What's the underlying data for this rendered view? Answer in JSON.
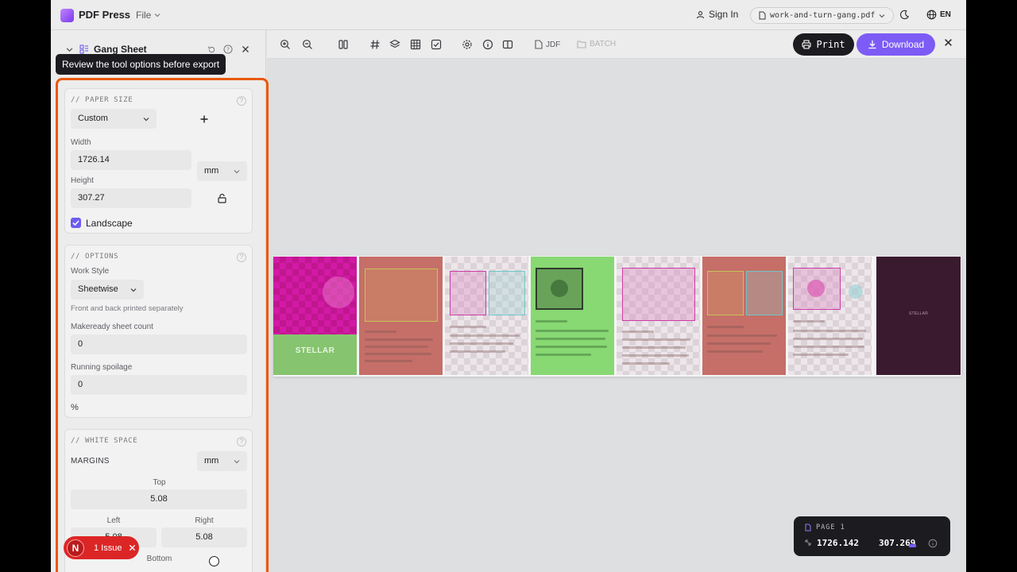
{
  "header": {
    "brand": "PDF Press",
    "file_menu": "File",
    "sign_in": "Sign In",
    "file_name": "work-and-turn-gang.pdf",
    "lang": "EN"
  },
  "sidebar": {
    "title": "Gang Sheet",
    "tooltip": "Review the tool options before export",
    "paper_size": {
      "heading": "// PAPER SIZE",
      "preset": "Custom",
      "width_label": "Width",
      "width_value": "1726.14",
      "unit": "mm",
      "height_label": "Height",
      "height_value": "307.27",
      "landscape_label": "Landscape",
      "landscape_checked": true
    },
    "options": {
      "heading": "// OPTIONS",
      "work_style_label": "Work Style",
      "work_style_value": "Sheetwise",
      "work_style_note": "Front and back printed separately",
      "makeready_label": "Makeready sheet count",
      "makeready_value": "0",
      "spoilage_label": "Running spoilage",
      "spoilage_value": "0",
      "spoilage_unit": "%"
    },
    "white_space": {
      "heading": "// WHITE SPACE",
      "margins_label": "MARGINS",
      "unit": "mm",
      "top_label": "Top",
      "top_value": "5.08",
      "left_label": "Left",
      "left_value": "5.08",
      "right_label": "Right",
      "right_value": "5.08",
      "bottom_label": "Bottom"
    }
  },
  "toolbar": {
    "jdf": "JDF",
    "batch": "BATCH",
    "print": "Print",
    "download": "Download"
  },
  "canvas": {
    "panel_text": "STELLAR",
    "panel_text_small": "STELLAR"
  },
  "page_info": {
    "label": "PAGE 1",
    "width": "1726.142",
    "height": "307.269"
  },
  "issues": {
    "badge": "N",
    "label": "1 Issue"
  },
  "colors": {
    "accent": "#7c5cf5",
    "highlight": "#ea580c",
    "issue": "#dc2626"
  }
}
